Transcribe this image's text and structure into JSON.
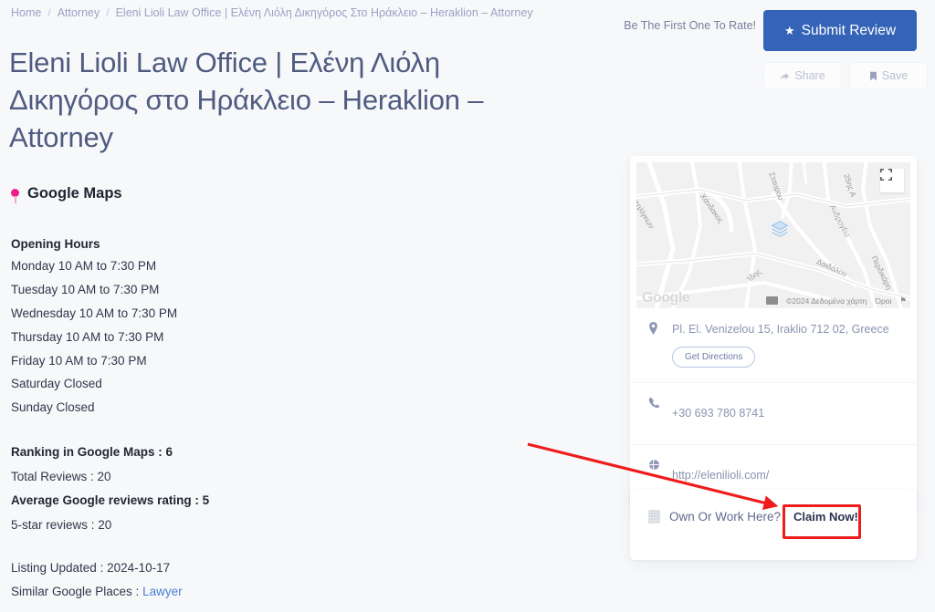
{
  "breadcrumb": {
    "home": "Home",
    "category": "Attorney",
    "separator": "/",
    "current": "Eleni Lioli Law Office | Ελένη Λιόλη Δικηγόρος Στο Ηράκλειο – Heraklion – Attorney"
  },
  "page_title": "Eleni Lioli Law Office | Ελένη Λιόλη Δικηγόρος στο Ηράκλειο – Heraklion – Attorney",
  "actions": {
    "rate_prompt": "Be The First One To Rate!",
    "submit_review": "Submit Review",
    "share": "Share",
    "save": "Save",
    "accent_color": "#3563b8"
  },
  "google_maps_heading": "Google Maps",
  "opening_hours": {
    "title": "Opening Hours",
    "rows": [
      "Monday 10 AM to 7:30 PM",
      "Tuesday 10 AM to 7:30 PM",
      "Wednesday 10 AM to 7:30 PM",
      "Thursday 10 AM to 7:30 PM",
      "Friday 10 AM to 7:30 PM",
      "Saturday Closed",
      "Sunday Closed"
    ]
  },
  "stats": {
    "ranking": "Ranking in Google Maps : 6",
    "total_reviews": "Total Reviews : 20",
    "average_rating": "Average Google reviews rating : 5",
    "five_star": "5-star reviews : 20"
  },
  "meta": {
    "listing_updated": "Listing Updated : 2024-10-17",
    "similar_label": "Similar Google Places : ",
    "similar_value": "Lawyer"
  },
  "map": {
    "attribution": "©2024 Δεδομένα χάρτη",
    "terms": "Όροι",
    "logo": "Google",
    "street_labels": [
      "Χάνδακος",
      "Ανδρογέω",
      "Δαιδάλου",
      "Περδικάρη",
      "Ίδης",
      "25ης Α",
      "Σταυρου",
      "μπηλίγκων"
    ]
  },
  "contact": {
    "address": "Pl. El. Venizelou 15, Iraklio 712 02, Greece",
    "directions": "Get Directions",
    "phone": "+30 693 780 8741",
    "website": "http://elenilioli.com/"
  },
  "claim": {
    "question": "Own Or Work Here?",
    "action": "Claim Now!",
    "highlight_color": "#ee1c1c"
  }
}
